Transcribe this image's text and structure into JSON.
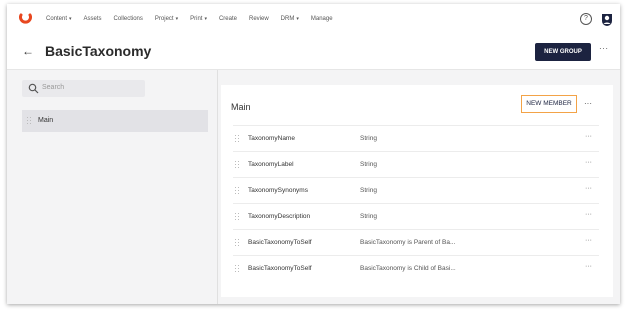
{
  "nav": {
    "items": [
      {
        "label": "Content",
        "caret": true
      },
      {
        "label": "Assets",
        "caret": false
      },
      {
        "label": "Collections",
        "caret": false
      },
      {
        "label": "Project",
        "caret": true
      },
      {
        "label": "Print",
        "caret": true
      },
      {
        "label": "Create",
        "caret": false
      },
      {
        "label": "Review",
        "caret": false
      },
      {
        "label": "DRM",
        "caret": true
      },
      {
        "label": "Manage",
        "caret": false
      }
    ],
    "help_glyph": "?",
    "brand_color": "#e8471f"
  },
  "header": {
    "back_glyph": "←",
    "title": "BasicTaxonomy",
    "new_group_label": "NEW GROUP",
    "more_glyph": "···"
  },
  "left": {
    "search_placeholder": "Search",
    "groups": [
      {
        "label": "Main"
      }
    ]
  },
  "group_card": {
    "title": "Main",
    "new_member_label": "NEW MEMBER",
    "more_glyph": "···",
    "members": [
      {
        "name": "TaxonomyName",
        "type": "String"
      },
      {
        "name": "TaxonomyLabel",
        "type": "String"
      },
      {
        "name": "TaxonomySynonyms",
        "type": "String"
      },
      {
        "name": "TaxonomyDescription",
        "type": "String"
      },
      {
        "name": "BasicTaxonomyToSelf",
        "type": "BasicTaxonomy is Parent of Ba..."
      },
      {
        "name": "BasicTaxonomyToSelf",
        "type": "BasicTaxonomy is Child of Basi..."
      }
    ],
    "row_more_glyph": "···"
  },
  "colors": {
    "accent_dark": "#1c2340",
    "accent_orange": "#f3a347"
  }
}
